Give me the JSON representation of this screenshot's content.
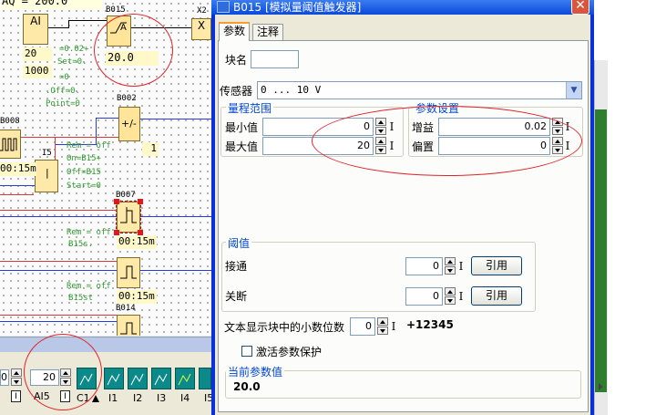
{
  "canvas": {
    "top_text": "AQ = 200.0",
    "blocks": {
      "ai_label": "AI",
      "ai_param_1": "20",
      "ai_param_2": "1000",
      "b015_id": "B015",
      "b015_value": "20.0",
      "x2_id": "X2",
      "b002_id": "B002",
      "b002_symbol": "+/-",
      "b002_value": "1",
      "b008_id": "B008",
      "i5_id": "I5",
      "i5_value": "00:15m",
      "b007_id": "B007",
      "b007_value": "00:15m",
      "b0xx_value": "00:15m",
      "b014_id": "B014"
    },
    "notes": {
      "n1": "=0.02+",
      "n2": "Set=0.",
      "n3": "=0",
      "n4": ".Off=0.",
      "n5": "Point=0",
      "n6": "Rem = off",
      "n7": "On=B15+",
      "n8": "Off=B15",
      "n9": "Start=0",
      "n10": "Rem = off",
      "n11": "B15s.",
      "n12": "Rem = off",
      "n13": "B15st"
    },
    "toolbar": {
      "left_value": "0",
      "ai5_value": "20",
      "ai5_label": "AI5",
      "tools": [
        "C1",
        "I1",
        "I2",
        "I3",
        "I4",
        "I5"
      ]
    }
  },
  "dialog": {
    "title": "B015 [模拟量阈值触发器]",
    "tabs": [
      "参数",
      "注释"
    ],
    "block_name_label": "块名",
    "block_name_value": "",
    "sensor_label": "传感器",
    "sensor_value": "0 ... 10 V",
    "range_group": "量程范围",
    "min_label": "最小值",
    "min_value": "0",
    "max_label": "最大值",
    "max_value": "20",
    "params_group": "参数设置",
    "gain_label": "增益",
    "gain_value": "0.02",
    "offset_label": "偏置",
    "offset_value": "0",
    "threshold_group": "阈值",
    "on_label": "接通",
    "on_value": "0",
    "off_label": "关断",
    "off_value": "0",
    "ref_button": "引用",
    "decimals_label": "文本显示块中的小数位数",
    "decimals_value": "0",
    "decimals_preview": "+12345",
    "protect_label": "激活参数保护",
    "current_group": "当前参数值",
    "current_value": "20.0"
  }
}
